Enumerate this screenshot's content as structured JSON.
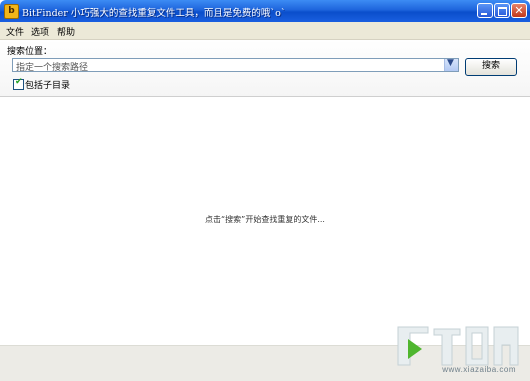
{
  "window": {
    "title": "BitFinder 小巧强大的查找重复文件工具，而且是免费的哦`o`",
    "app_icon_letter": "b"
  },
  "menu": {
    "items": [
      {
        "label": "文件"
      },
      {
        "label": "选项"
      },
      {
        "label": "帮助"
      }
    ]
  },
  "search": {
    "location_label": "搜索位置：",
    "path_placeholder": "指定一个搜索路径",
    "search_button": "搜索",
    "include_subdirs_label": "包括子目录",
    "include_subdirs_checked": true
  },
  "main": {
    "empty_message": "点击“搜索”开始查找重复的文件..."
  },
  "watermark": {
    "text": "www.xiazaiba.com"
  },
  "colors": {
    "titlebar": "#1e64dc",
    "menubar": "#ece9d8",
    "checkmark": "#21a121"
  }
}
